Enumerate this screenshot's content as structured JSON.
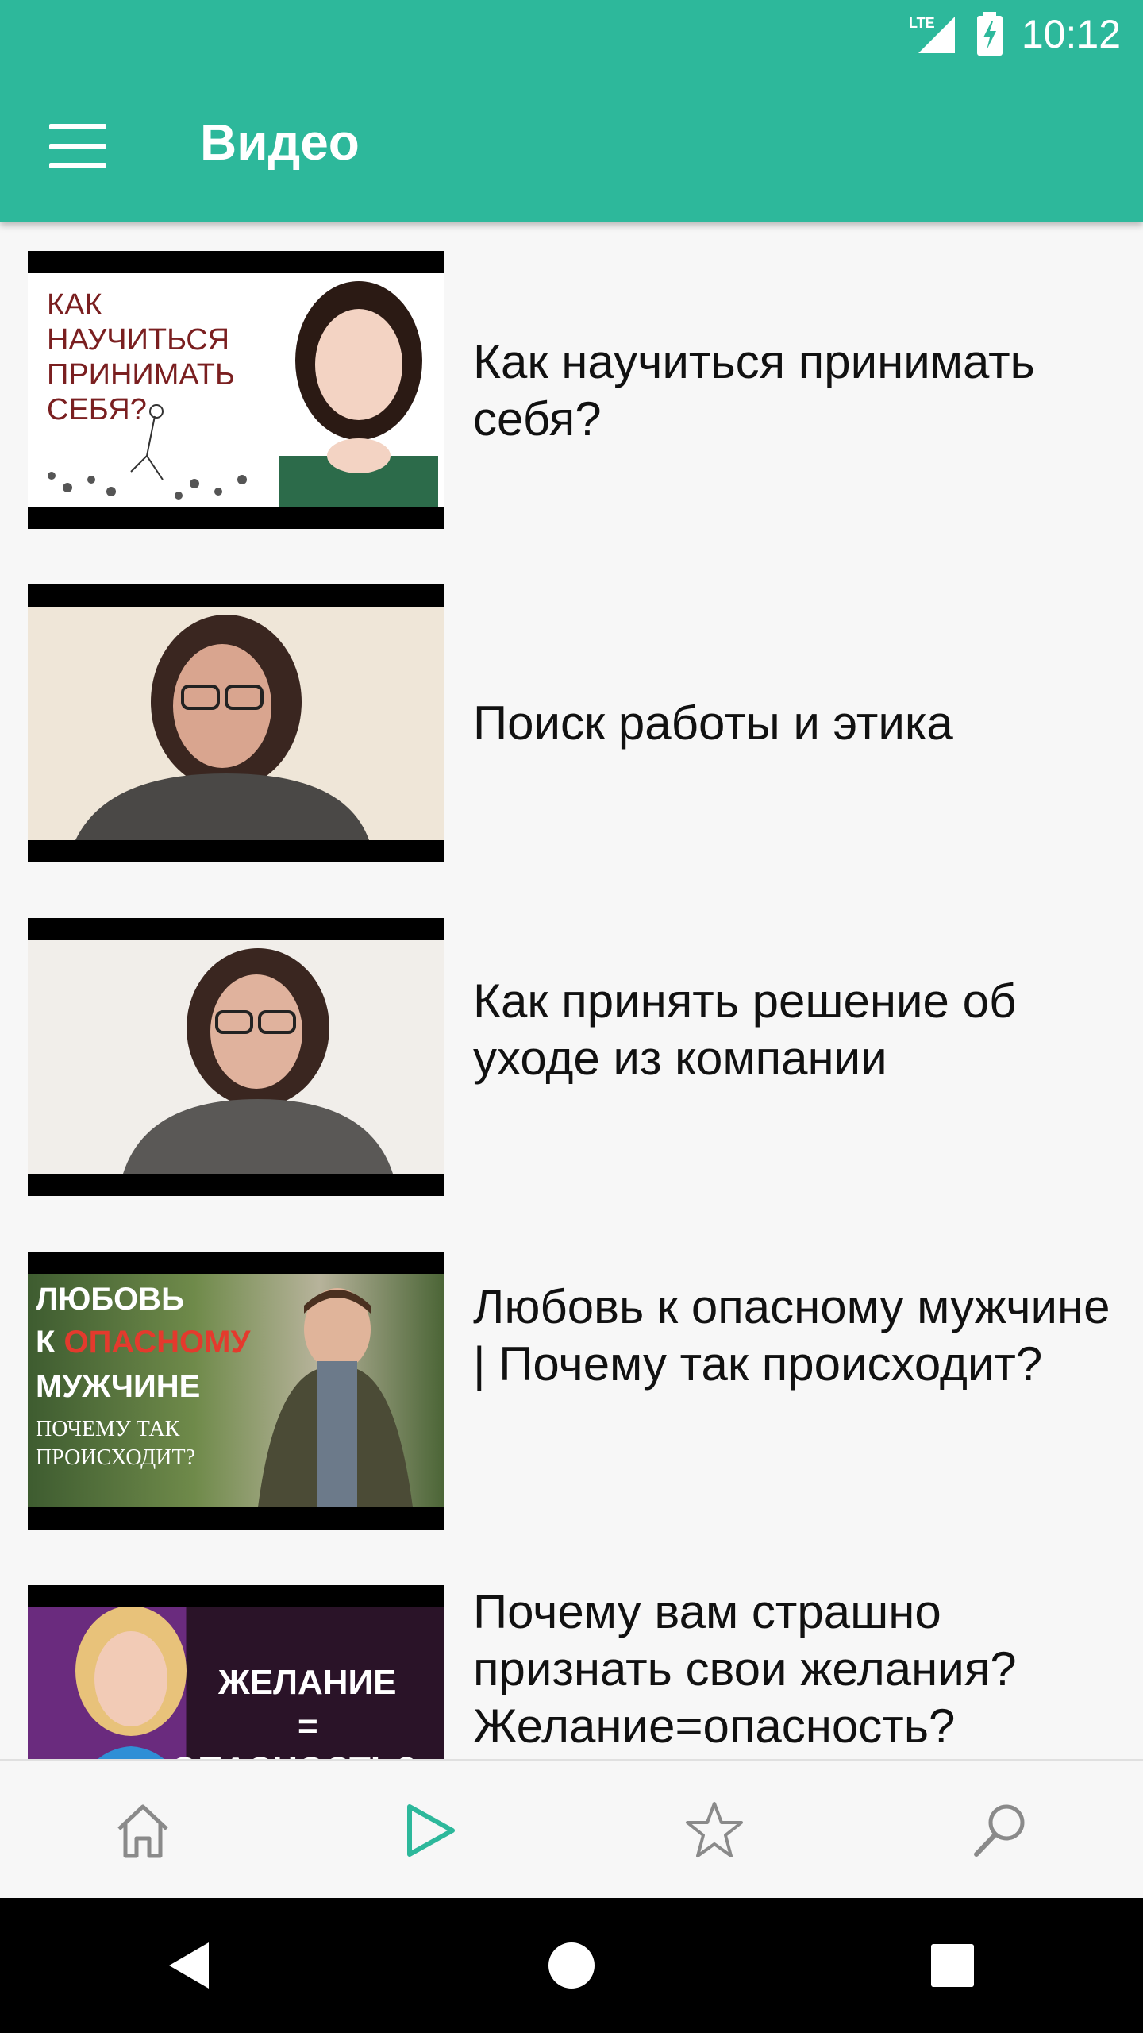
{
  "status_bar": {
    "network": "LTE",
    "time": "10:12"
  },
  "app_bar": {
    "title": "Видео",
    "menu_icon": "hamburger-menu-icon"
  },
  "videos": [
    {
      "title": "Как научиться принимать себя?",
      "thumb_text": "КАК НАУЧИТЬСЯ ПРИНИМАТЬ СЕБЯ?"
    },
    {
      "title": "Поиск работы и этика"
    },
    {
      "title": "Как принять решение об уходе из компании"
    },
    {
      "title": "Любовь к опасному мужчине | Почему так происходит?",
      "thumb_line1": "ЛЮБОВЬ",
      "thumb_line2a": "К ",
      "thumb_line2b": "ОПАСНОМУ",
      "thumb_line3": "МУЖЧИНЕ",
      "thumb_line4": "ПОЧЕМУ ТАК ПРОИСХОДИТ?"
    },
    {
      "title": "Почему вам страшно признать свои желания? Желание=опасность?",
      "thumb_line1": "ЖЕЛАНИЕ",
      "thumb_line2": "=",
      "thumb_line3": "ОПАСНОСТЬ?"
    }
  ],
  "bottom_nav": [
    {
      "name": "home",
      "icon": "home-icon",
      "active": false
    },
    {
      "name": "video",
      "icon": "play-icon",
      "active": true
    },
    {
      "name": "favorites",
      "icon": "star-icon",
      "active": false
    },
    {
      "name": "search",
      "icon": "search-icon",
      "active": false
    }
  ],
  "colors": {
    "primary": "#2db89b",
    "accent": "#2db89b",
    "inactive_icon": "#8a8a8a"
  }
}
